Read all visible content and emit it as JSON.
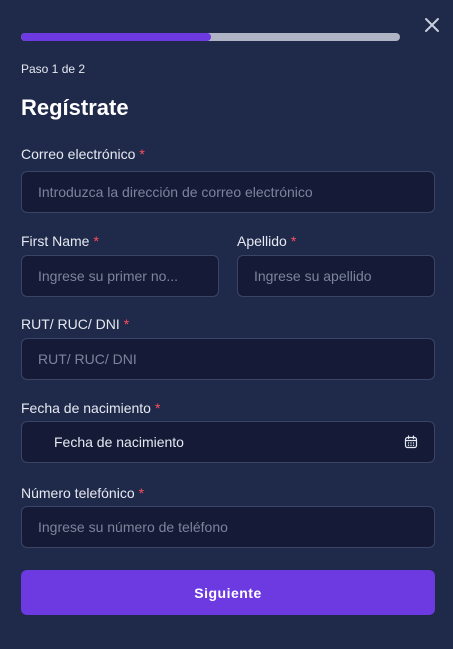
{
  "progress": {
    "fraction": 0.5,
    "step_text": "Paso 1 de 2"
  },
  "title": "Regístrate",
  "required_marker": "*",
  "fields": {
    "email": {
      "label": "Correo electrónico",
      "placeholder": "Introduzca la dirección de correo electrónico"
    },
    "first_name": {
      "label": "First Name",
      "placeholder": "Ingrese su primer no..."
    },
    "last_name": {
      "label": "Apellido",
      "placeholder": "Ingrese su apellido"
    },
    "id_number": {
      "label": "RUT/ RUC/ DNI",
      "placeholder": "RUT/ RUC/ DNI"
    },
    "birthdate": {
      "label": "Fecha de nacimiento",
      "value": "Fecha de nacimiento",
      "icon": "calendar-icon"
    },
    "phone": {
      "label": "Número telefónico",
      "placeholder": "Ingrese su número de teléfono"
    }
  },
  "submit_label": "Siguiente",
  "close_icon": "close-icon",
  "colors": {
    "accent": "#6c3ae0",
    "background": "#1f2a4a",
    "input_bg": "#151b36",
    "required": "#ff4d5e"
  }
}
